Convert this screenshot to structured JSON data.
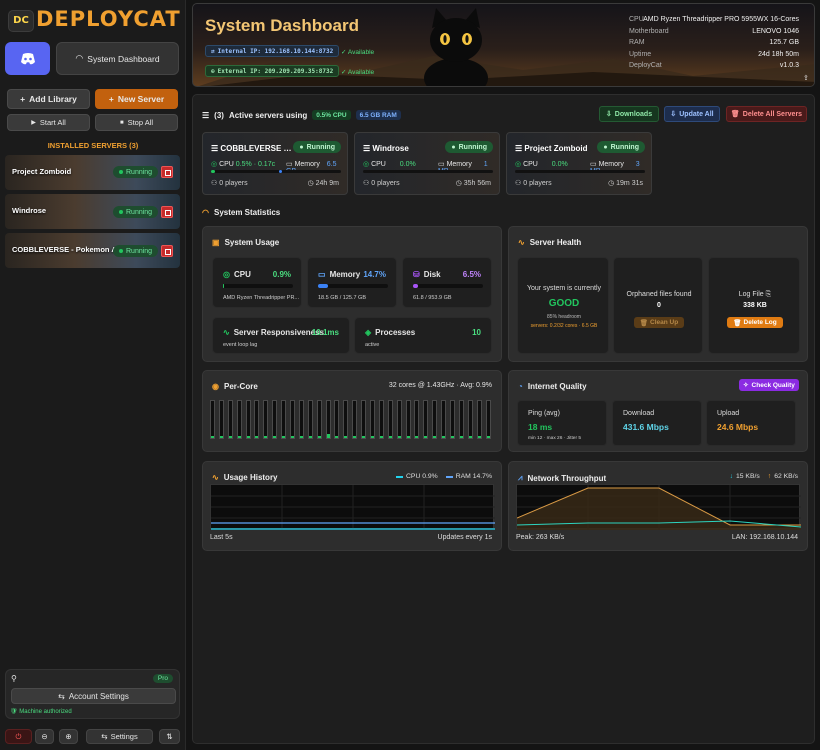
{
  "app": {
    "logo_mark": "DC",
    "logo_text": "DEPLOYCAT"
  },
  "sidebar": {
    "system_dashboard_label": "System Dashboard",
    "add_library_label": "Add Library",
    "new_server_label": "New Server",
    "start_all_label": "Start All",
    "stop_all_label": "Stop All",
    "installed_title": "INSTALLED SERVERS (3)",
    "servers": [
      {
        "name": "Project Zomboid",
        "status": "Running"
      },
      {
        "name": "Windrose",
        "status": "Running"
      },
      {
        "name": "COBBLEVERSE - Pokemon Ad...",
        "status": "Running"
      }
    ],
    "account": {
      "pro_label": "Pro",
      "account_settings_label": "Account Settings",
      "authorized_text": "Machine authorized"
    },
    "settings_label": "Settings"
  },
  "header": {
    "title": "System Dashboard",
    "internal_ip": "Internal IP: 192.168.10.144:8732",
    "external_ip": "External IP: 209.209.209.35:8732",
    "internal_status": "Available",
    "external_status": "Available",
    "specs": [
      {
        "key": "CPU",
        "value": "AMD Ryzen Threadripper PRO 5955WX 16-Cores"
      },
      {
        "key": "Motherboard",
        "value": "LENOVO 1046"
      },
      {
        "key": "RAM",
        "value": "125.7 GB"
      },
      {
        "key": "Uptime",
        "value": "24d 18h 50m"
      },
      {
        "key": "DeployCat",
        "value": "v1.0.3"
      }
    ],
    "version_right": "v1.0.3"
  },
  "active": {
    "count_label": "(3)",
    "title": "Active servers using",
    "cpu_pill": "0.5% CPU",
    "ram_pill": "6.5 GB RAM",
    "downloads_label": "Downloads",
    "update_all_label": "Update All",
    "delete_all_label": "Delete All Servers",
    "cards": [
      {
        "name": "COBBLEVERSE - Pokemon Adventure",
        "status": "Running",
        "cpu_label": "CPU",
        "cpu": "0.5% · 0.17c",
        "mem_label": "Memory",
        "mem": "6.5 GB",
        "cpu_pct": 3,
        "mem_pct": 52,
        "players": "0 players",
        "uptime": "24h 9m"
      },
      {
        "name": "Windrose",
        "status": "Running",
        "cpu_label": "CPU",
        "cpu": "0.0%",
        "mem_label": "Memory",
        "mem": "1 MB",
        "cpu_pct": 0,
        "mem_pct": 0,
        "players": "0 players",
        "uptime": "35h 56m"
      },
      {
        "name": "Project Zomboid",
        "status": "Running",
        "cpu_label": "CPU",
        "cpu": "0.0%",
        "mem_label": "Memory",
        "mem": "3 MB",
        "cpu_pct": 0,
        "mem_pct": 0,
        "players": "0 players",
        "uptime": "19m 31s"
      }
    ]
  },
  "stats_title": "System Statistics",
  "usage": {
    "title": "System Usage",
    "cpu": {
      "label": "CPU",
      "value": "0.9%",
      "sub": "AMD Ryzen Threadripper PR...",
      "pct": 1
    },
    "memory": {
      "label": "Memory",
      "value": "14.7%",
      "sub": "18.5 GB / 125.7 GB",
      "pct": 14.7
    },
    "disk": {
      "label": "Disk",
      "value": "6.5%",
      "sub": "61.8 / 953.9 GB",
      "pct": 6.5
    },
    "responsiveness": {
      "label": "Server Responsiveness",
      "value": "10.1ms",
      "sub": "event loop lag"
    },
    "processes": {
      "label": "Processes",
      "value": "10",
      "sub": "active"
    }
  },
  "health": {
    "title": "Server Health",
    "intro": "Your system is currently",
    "state": "GOOD",
    "headroom": "85% headroom",
    "detail": "servers: 0.2/32 cores · 6.5 GB",
    "orphaned_label": "Orphaned files found",
    "orphaned_value": "0",
    "clean_up_label": "Clean Up",
    "log_label": "Log File",
    "log_size": "338 KB",
    "delete_log_label": "Delete Log"
  },
  "percore": {
    "title": "Per-Core",
    "summary": "32 cores @ 1.43GHz · Avg: 0.9%",
    "core_count": 32
  },
  "internet": {
    "title": "Internet Quality",
    "check_label": "Check Quality",
    "ping_label": "Ping (avg)",
    "ping_value": "18 ms",
    "ping_sub": "min 12 · max 26 · Jitter 5",
    "download_label": "Download",
    "download_value": "431.6 Mbps",
    "upload_label": "Upload",
    "upload_value": "24.6 Mbps"
  },
  "usage_history": {
    "title": "Usage History",
    "cpu_legend": "CPU 0.9%",
    "ram_legend": "RAM 14.7%",
    "left_footer": "Last 5s",
    "right_footer": "Updates every 1s"
  },
  "network": {
    "title": "Network Throughput",
    "down_legend": "15 KB/s",
    "up_legend": "62 KB/s",
    "left_footer": "Peak: 263 KB/s",
    "right_footer": "LAN: 192.168.10.144"
  },
  "colors": {
    "accent": "#f0a030",
    "green": "#22c55e",
    "blue": "#3b82f6",
    "purple": "#a855f7",
    "red": "#c62b2b"
  }
}
